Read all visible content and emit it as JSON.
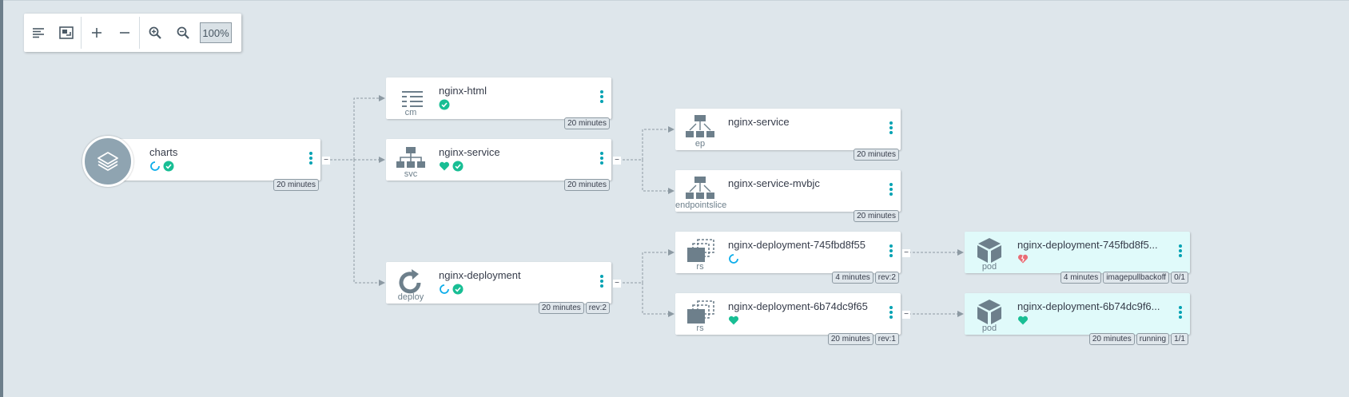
{
  "toolbar": {
    "zoom": "100%",
    "buttons": [
      "list-icon",
      "fit-screen-icon",
      "expand-icon",
      "collapse-icon",
      "zoom-in-icon",
      "zoom-out-icon"
    ]
  },
  "colors": {
    "healthy": "#18be94",
    "progressing": "#0dadea",
    "degraded": "#e96d76",
    "accent": "#00a2b3",
    "pod_bg": "#e0fafa"
  },
  "app": {
    "name": "charts",
    "age": "20 minutes",
    "statuses": [
      "progressing",
      "synced"
    ]
  },
  "nodes": {
    "cm_html": {
      "kind": "cm",
      "name": "nginx-html",
      "age": "20 minutes",
      "statuses": [
        "synced"
      ]
    },
    "svc": {
      "kind": "svc",
      "name": "nginx-service",
      "age": "20 minutes",
      "statuses": [
        "healthy",
        "synced"
      ]
    },
    "deploy": {
      "kind": "deploy",
      "name": "nginx-deployment",
      "age": "20 minutes",
      "rev": "rev:2",
      "statuses": [
        "progressing",
        "synced"
      ]
    },
    "ep": {
      "kind": "ep",
      "name": "nginx-service",
      "age": "20 minutes",
      "statuses": []
    },
    "eps": {
      "kind": "endpointslice",
      "name": "nginx-service-mvbjc",
      "age": "20 minutes",
      "statuses": []
    },
    "rs1": {
      "kind": "rs",
      "name": "nginx-deployment-745fbd8f55",
      "age": "4 minutes",
      "rev": "rev:2",
      "statuses": [
        "progressing"
      ]
    },
    "rs2": {
      "kind": "rs",
      "name": "nginx-deployment-6b74dc9f65",
      "age": "20 minutes",
      "rev": "rev:1",
      "statuses": [
        "healthy"
      ]
    },
    "pod1": {
      "kind": "pod",
      "name": "nginx-deployment-745fbd8f5...",
      "age": "4 minutes",
      "state": "imagepullbackoff",
      "ready": "0/1",
      "statuses": [
        "degraded"
      ]
    },
    "pod2": {
      "kind": "pod",
      "name": "nginx-deployment-6b74dc9f6...",
      "age": "20 minutes",
      "state": "running",
      "ready": "1/1",
      "statuses": [
        "healthy"
      ]
    }
  }
}
